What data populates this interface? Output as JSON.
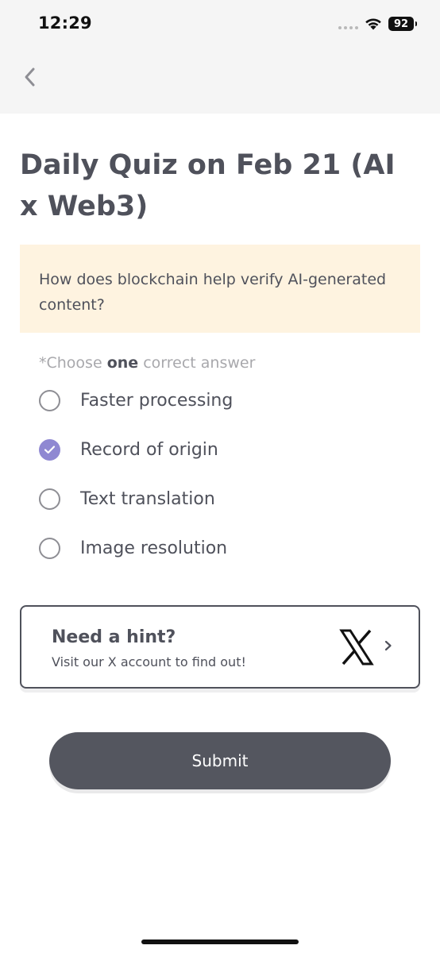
{
  "status_bar": {
    "time": "12:29",
    "battery": "92"
  },
  "nav": {
    "back_icon": "chevron-left-icon"
  },
  "quiz": {
    "title": "Daily Quiz on Feb 21 (AI x Web3)",
    "question": "How does blockchain help verify AI-generated content?",
    "instruction_prefix": "*Choose ",
    "instruction_bold": "one",
    "instruction_suffix": " correct answer",
    "options": [
      {
        "label": "Faster processing",
        "selected": false
      },
      {
        "label": "Record of origin",
        "selected": true
      },
      {
        "label": "Text translation",
        "selected": false
      },
      {
        "label": "Image resolution",
        "selected": false
      }
    ]
  },
  "hint": {
    "title": "Need a hint?",
    "subtitle": "Visit our X account to find out!",
    "icon": "x-logo-icon"
  },
  "submit_label": "Submit",
  "colors": {
    "accent": "#8f88d2",
    "text": "#4f515b",
    "question_bg": "#fef3e0",
    "button_bg": "#54565f"
  }
}
